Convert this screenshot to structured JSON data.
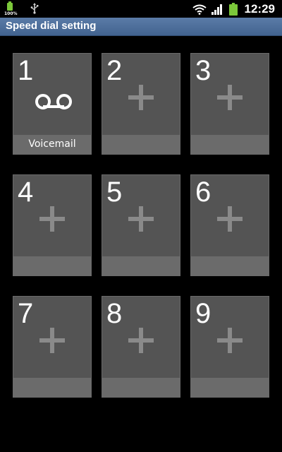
{
  "status_bar": {
    "battery_small_text": "100%",
    "time": "12:29",
    "icons": [
      "battery-icon",
      "usb-icon",
      "wifi-icon",
      "signal-icon",
      "battery-icon"
    ]
  },
  "header": {
    "title": "Speed dial setting"
  },
  "speed_dial": {
    "slots": [
      {
        "number": "1",
        "label": "Voicemail",
        "icon": "voicemail-icon"
      },
      {
        "number": "2",
        "label": "",
        "icon": "plus-icon"
      },
      {
        "number": "3",
        "label": "",
        "icon": "plus-icon"
      },
      {
        "number": "4",
        "label": "",
        "icon": "plus-icon"
      },
      {
        "number": "5",
        "label": "",
        "icon": "plus-icon"
      },
      {
        "number": "6",
        "label": "",
        "icon": "plus-icon"
      },
      {
        "number": "7",
        "label": "",
        "icon": "plus-icon"
      },
      {
        "number": "8",
        "label": "",
        "icon": "plus-icon"
      },
      {
        "number": "9",
        "label": "",
        "icon": "plus-icon"
      }
    ]
  },
  "colors": {
    "background": "#000000",
    "title_bar": "#4e6f9c",
    "tile": "#545454",
    "label_bar": "#6b6b6b",
    "plus": "#8a8a8a",
    "battery_green": "#7cc83a"
  }
}
